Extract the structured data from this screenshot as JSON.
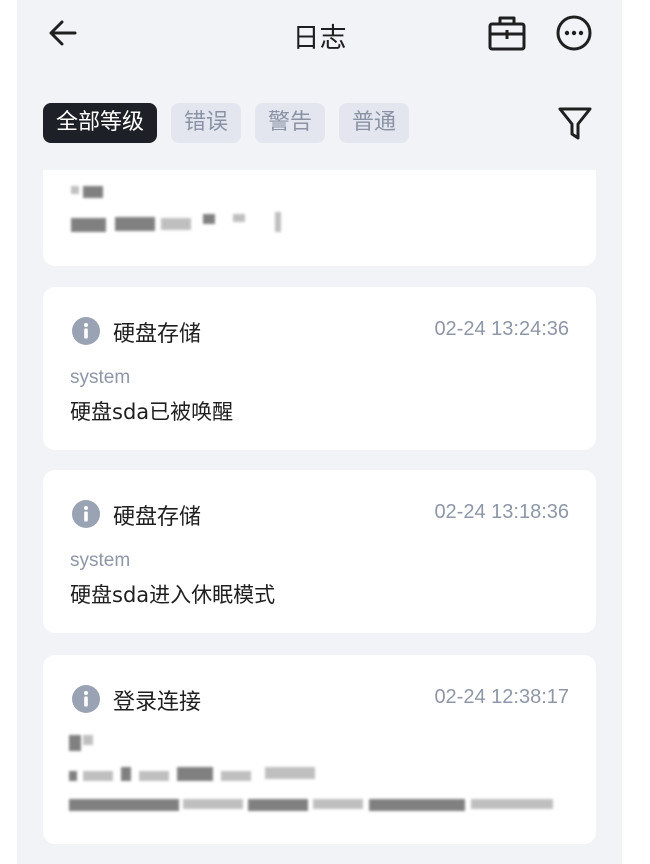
{
  "header": {
    "title": "日志",
    "icons": {
      "back": "arrow-left-icon",
      "briefcase": "briefcase-icon",
      "more": "more-horizontal-icon"
    }
  },
  "filters": {
    "chips": [
      {
        "label": "全部等级",
        "active": true
      },
      {
        "label": "错误",
        "active": false
      },
      {
        "label": "警告",
        "active": false
      },
      {
        "label": "普通",
        "active": false
      }
    ],
    "icon": "funnel-filter-icon"
  },
  "logs": [
    {
      "title": "硬盘存储",
      "time": "02-24 13:24:36",
      "source": "system",
      "message": "硬盘sda已被唤醒",
      "icon": "info-icon"
    },
    {
      "title": "硬盘存储",
      "time": "02-24 13:18:36",
      "source": "system",
      "message": "硬盘sda进入休眠模式",
      "icon": "info-icon"
    },
    {
      "title": "登录连接",
      "time": "02-24 12:38:17",
      "icon": "info-icon"
    }
  ],
  "colors": {
    "background": "#f2f3f7",
    "card": "#ffffff",
    "chip_active_bg": "#1d2026",
    "chip_inactive_bg": "#e3e6ee",
    "chip_inactive_text": "#8a93a6",
    "info_icon": "#9aa3b3"
  }
}
